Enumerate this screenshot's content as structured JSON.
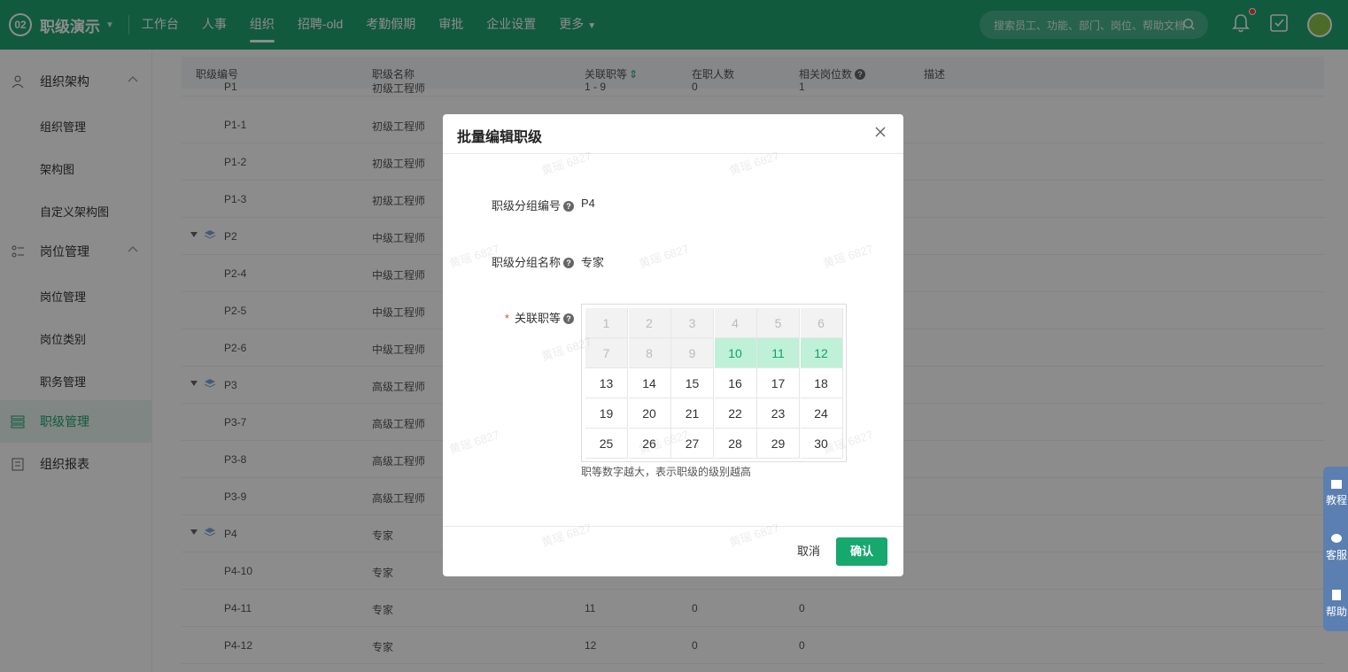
{
  "header": {
    "logo": "02",
    "app_title": "职级演示",
    "nav": [
      "工作台",
      "人事",
      "组织",
      "招聘-old",
      "考勤假期",
      "审批",
      "企业设置",
      "更多"
    ],
    "search_placeholder": "搜索员工、功能、部门、岗位、帮助文档"
  },
  "sidebar": {
    "group1": "组织架构",
    "group1_items": [
      "组织管理",
      "架构图",
      "自定义架构图"
    ],
    "group2": "岗位管理",
    "group2_items": [
      "岗位管理",
      "岗位类别",
      "职务管理"
    ],
    "active": "职级管理",
    "report": "组织报表"
  },
  "table": {
    "headers": [
      "职级编号",
      "职级名称",
      "关联职等",
      "在职人数",
      "相关岗位数",
      "描述"
    ],
    "partial_row": [
      "P1",
      "初级工程师",
      "1 - 9",
      "0",
      "1"
    ],
    "rows": [
      {
        "code": "P1-1",
        "name": "初级工程师",
        "grade": "",
        "count": "",
        "posts": ""
      },
      {
        "code": "P1-2",
        "name": "初级工程师",
        "grade": "",
        "count": "",
        "posts": ""
      },
      {
        "code": "P1-3",
        "name": "初级工程师",
        "grade": "",
        "count": "",
        "posts": ""
      },
      {
        "code": "P2",
        "name": "中级工程师",
        "grade": "",
        "count": "",
        "posts": "",
        "group": true
      },
      {
        "code": "P2-4",
        "name": "中级工程师",
        "grade": "",
        "count": "",
        "posts": ""
      },
      {
        "code": "P2-5",
        "name": "中级工程师",
        "grade": "",
        "count": "",
        "posts": ""
      },
      {
        "code": "P2-6",
        "name": "中级工程师",
        "grade": "",
        "count": "",
        "posts": ""
      },
      {
        "code": "P3",
        "name": "高级工程师",
        "grade": "",
        "count": "",
        "posts": "",
        "group": true
      },
      {
        "code": "P3-7",
        "name": "高级工程师",
        "grade": "",
        "count": "",
        "posts": ""
      },
      {
        "code": "P3-8",
        "name": "高级工程师",
        "grade": "",
        "count": "",
        "posts": ""
      },
      {
        "code": "P3-9",
        "name": "高级工程师",
        "grade": "",
        "count": "",
        "posts": ""
      },
      {
        "code": "P4",
        "name": "专家",
        "grade": "",
        "count": "",
        "posts": "",
        "group": true
      },
      {
        "code": "P4-10",
        "name": "专家",
        "grade": "",
        "count": "",
        "posts": ""
      },
      {
        "code": "P4-11",
        "name": "专家",
        "grade": "11",
        "count": "0",
        "posts": "0"
      },
      {
        "code": "P4-12",
        "name": "专家",
        "grade": "12",
        "count": "0",
        "posts": "0"
      }
    ]
  },
  "float_tools": [
    "教程",
    "客服",
    "帮助"
  ],
  "modal": {
    "title": "批量编辑职级",
    "group_code_label": "职级分组编号",
    "group_code_value": "P4",
    "group_name_label": "职级分组名称",
    "group_name_value": "专家",
    "grade_label": "关联职等",
    "required_mark": "*",
    "help_mark": "?",
    "grades": [
      "1",
      "2",
      "3",
      "4",
      "5",
      "6",
      "7",
      "8",
      "9",
      "10",
      "11",
      "12",
      "13",
      "14",
      "15",
      "16",
      "17",
      "18",
      "19",
      "20",
      "21",
      "22",
      "23",
      "24",
      "25",
      "26",
      "27",
      "28",
      "29",
      "30"
    ],
    "disabled_grades": [
      "1",
      "2",
      "3",
      "4",
      "5",
      "6",
      "7",
      "8",
      "9"
    ],
    "selected_grades": [
      "10",
      "11",
      "12"
    ],
    "hint": "职等数字越大，表示职级的级别越高",
    "cancel": "取消",
    "confirm": "确认",
    "watermark": "黄瑶 6827"
  },
  "colors": {
    "brand": "#1fa471",
    "selected_bg": "#bff0d8",
    "selected_text": "#13a067"
  }
}
